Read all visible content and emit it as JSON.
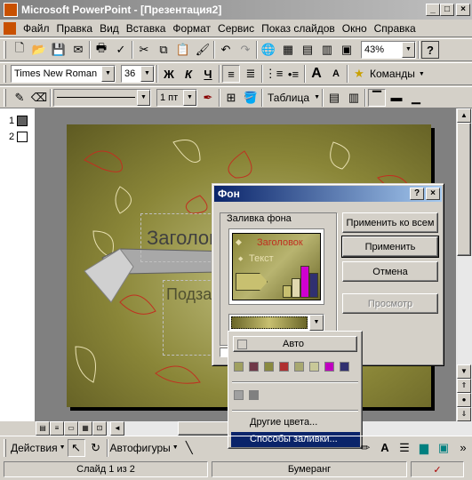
{
  "window": {
    "title": "Microsoft PowerPoint - [Презентация2]",
    "min": "_",
    "max": "□",
    "close": "×"
  },
  "menu": [
    "Файл",
    "Правка",
    "Вид",
    "Вставка",
    "Формат",
    "Сервис",
    "Показ слайдов",
    "Окно",
    "Справка"
  ],
  "standard_toolbar": {
    "zoom": "43%",
    "help": "?"
  },
  "format_toolbar": {
    "font": "Times New Roman",
    "size": "36",
    "bold": "Ж",
    "italic": "К",
    "underline": "Ч",
    "commands": "Команды"
  },
  "drawing_toolbar_top": {
    "line_weight": "1 пт",
    "table": "Таблица"
  },
  "outline": {
    "slides": [
      "1",
      "2"
    ]
  },
  "slide": {
    "title_placeholder": "Заголов",
    "subtitle_placeholder": "Подзаг"
  },
  "dialog": {
    "title": "Фон",
    "help": "?",
    "close": "×",
    "group_label": "Заливка фона",
    "preview": {
      "heading": "Заголовок",
      "text": "Текст"
    },
    "buttons": {
      "apply_all": "Применить ко всем",
      "apply": "Применить",
      "cancel": "Отмена",
      "preview": "Просмотр"
    }
  },
  "popup": {
    "auto": "Авто",
    "swatches": [
      "#a0a060",
      "#703848",
      "#8a8a40",
      "#b03030",
      "#a8a870",
      "#c8c898",
      "#c000c0",
      "#303070"
    ],
    "recent": [
      "#a0a0a0",
      "#808080"
    ],
    "more_colors": "Другие цвета...",
    "fill_effects": "Способы заливки..."
  },
  "bottom_toolbar": {
    "actions": "Действия",
    "autoshapes": "Автофигуры"
  },
  "status": {
    "slide": "Слайд 1 из 2",
    "design": "Бумеранг"
  }
}
